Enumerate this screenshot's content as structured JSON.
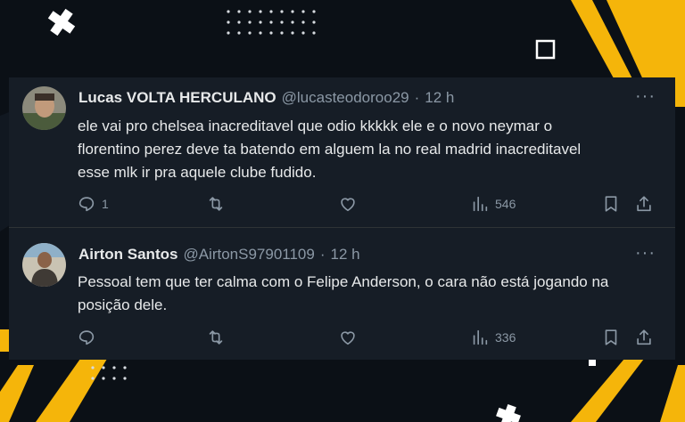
{
  "tweets": [
    {
      "name": "Lucas VOLTA HERCULANO",
      "handle": "@lucasteodoroo29",
      "dot": "·",
      "time": "12 h",
      "more": "···",
      "lines": [
        "ele vai pro chelsea inacreditavel que odio kkkkk ele e o novo neymar o",
        "florentino perez deve ta batendo em alguem la no real madrid inacreditavel",
        "esse mlk ir pra aquele clube fudido."
      ],
      "replies": "1",
      "retweets": "",
      "likes": "",
      "views": "546"
    },
    {
      "name": "Airton Santos",
      "handle": "@AirtonS97901109",
      "dot": "·",
      "time": "12 h",
      "more": "···",
      "lines": [
        "Pessoal tem que ter calma com o Felipe Anderson, o cara não está jogando na",
        "posição dele."
      ],
      "replies": "",
      "retweets": "",
      "likes": "",
      "views": "336"
    }
  ],
  "icons": [
    "reply-icon",
    "retweet-icon",
    "like-icon",
    "views-icon",
    "bookmark-icon",
    "share-icon"
  ],
  "colors": {
    "accent": "#f5b50a",
    "card": "#161d26",
    "muted": "#8b98a5",
    "text": "#e7e9ea"
  }
}
